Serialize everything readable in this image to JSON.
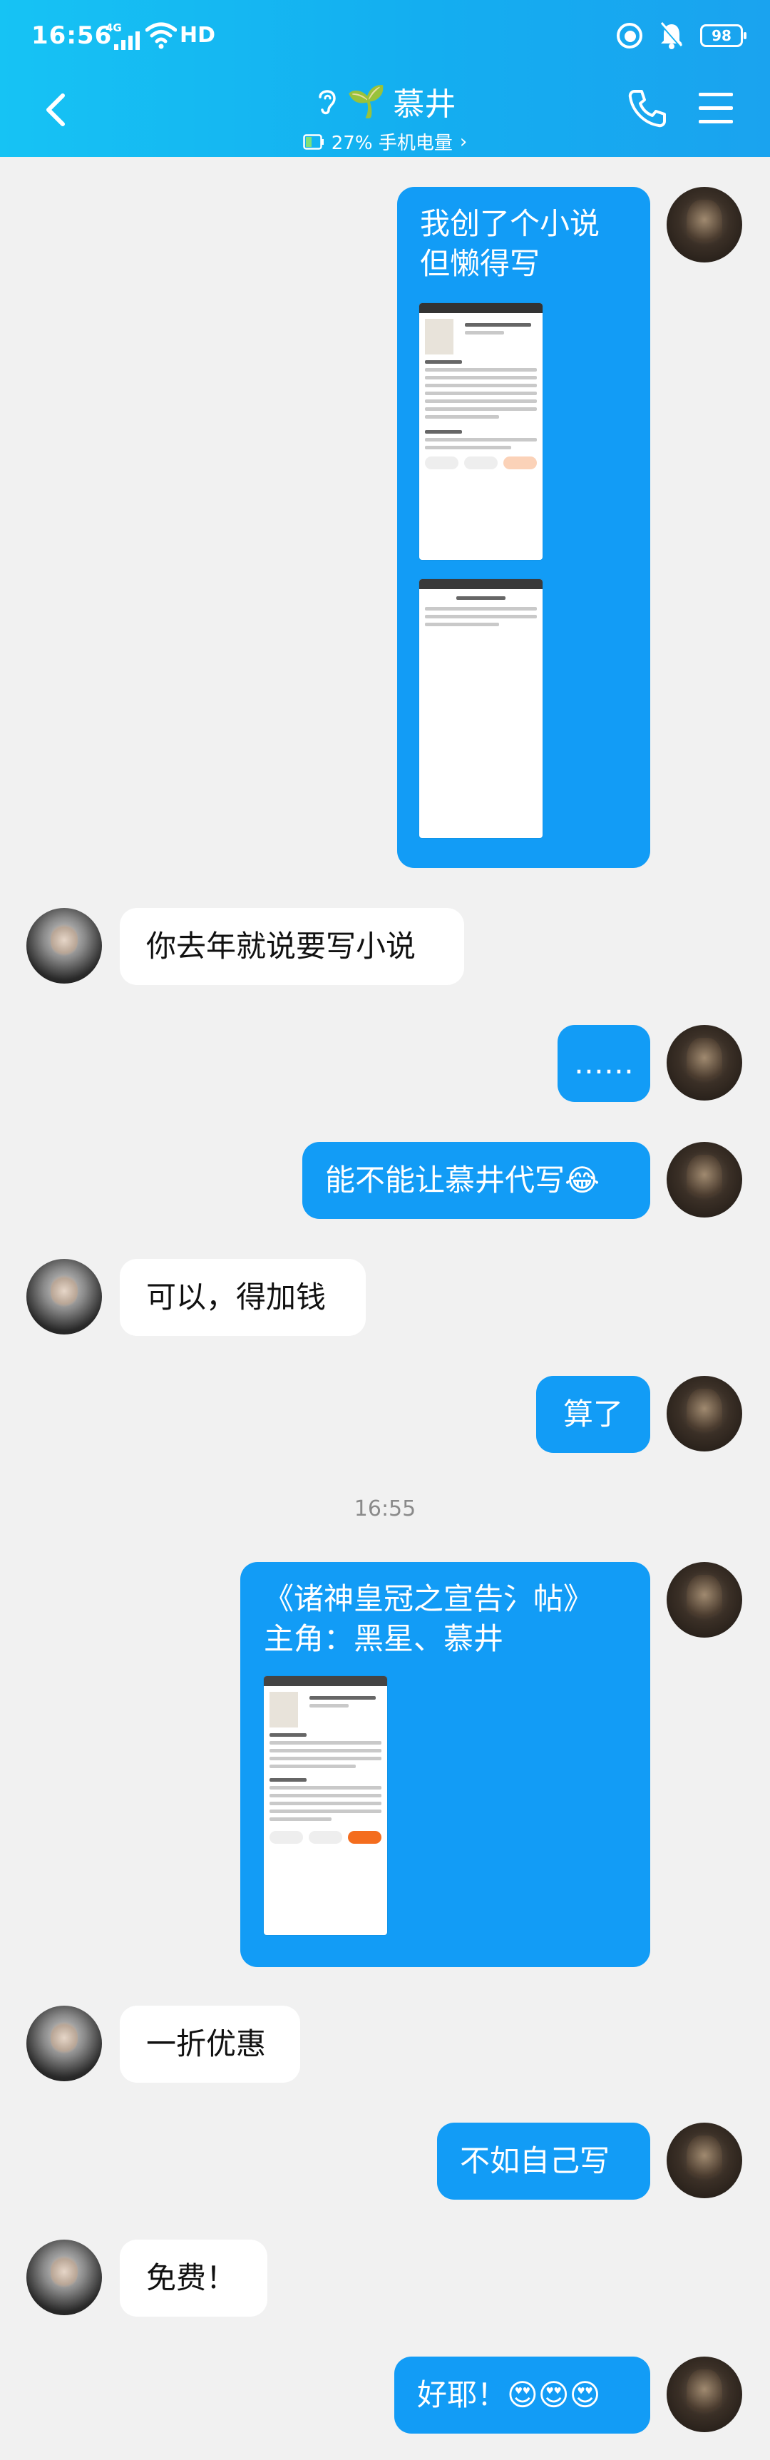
{
  "status_bar": {
    "time": "16:56",
    "network": "4G",
    "hd": "HD",
    "battery": "98",
    "icons": [
      "signal-icon",
      "wifi-icon",
      "nfc-icon",
      "mute-bell-icon",
      "battery-icon"
    ]
  },
  "header": {
    "contact_name": "慕井",
    "contact_emoji": "🌱",
    "subtitle": "27% 手机电量",
    "subtitle_chevron": "›",
    "icons": [
      "back-arrow-icon",
      "ear-icon",
      "battery-small-icon",
      "phone-icon",
      "menu-icon"
    ]
  },
  "colors": {
    "header_start": "#16c3f4",
    "header_end": "#1aa3ef",
    "outgoing_bubble": "#129cf6",
    "incoming_bubble": "#ffffff",
    "background": "#f1f1f1"
  },
  "messages": [
    {
      "from": "me",
      "lines": [
        "我创了个小说",
        "但懒得写"
      ],
      "has_images": true
    },
    {
      "from": "other",
      "lines": [
        "你去年就说要写小说"
      ]
    },
    {
      "from": "me",
      "lines": [
        "……"
      ]
    },
    {
      "from": "me",
      "lines": [
        "能不能让慕井代写😂"
      ]
    },
    {
      "from": "other",
      "lines": [
        "可以，得加钱"
      ]
    },
    {
      "from": "me",
      "lines": [
        "算了"
      ]
    },
    {
      "timestamp": "16:55"
    },
    {
      "from": "me",
      "lines": [
        "《诸神皇冠之宣告氵帖》",
        "主角：黑星、慕井"
      ],
      "has_images": true
    },
    {
      "from": "other",
      "lines": [
        "一折优惠"
      ]
    },
    {
      "from": "me",
      "lines": [
        "不如自己写"
      ]
    },
    {
      "from": "other",
      "lines": [
        "免费！"
      ]
    },
    {
      "from": "me",
      "lines": [
        "好耶！😍😍😍"
      ]
    }
  ]
}
